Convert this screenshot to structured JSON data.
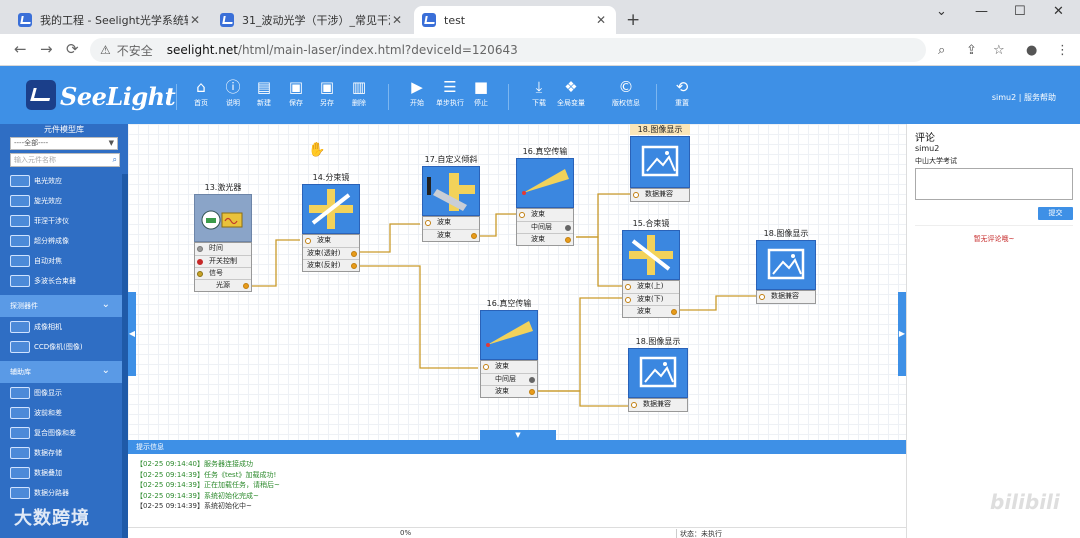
{
  "browser": {
    "tabs": [
      {
        "title": "我的工程 - Seelight光学系统辅助..."
      },
      {
        "title": "31_波动光学（干涉）_常见干涉..."
      },
      {
        "title": "test"
      }
    ],
    "url_warning": "不安全",
    "url_host": "seelight.net",
    "url_path": "/html/main-laser/index.html?deviceId=120643"
  },
  "app": {
    "logo_text": "SeeLight",
    "toolbar": [
      {
        "label": "首页",
        "icon": "home-icon",
        "glyph": "⌂"
      },
      {
        "label": "说明",
        "icon": "info-icon",
        "glyph": "ⓘ"
      },
      {
        "label": "新建",
        "icon": "new-file-icon",
        "glyph": "▤"
      },
      {
        "label": "保存",
        "icon": "save-icon",
        "glyph": "▣"
      },
      {
        "label": "另存",
        "icon": "save-as-icon",
        "glyph": "▣"
      },
      {
        "label": "删除",
        "icon": "delete-icon",
        "glyph": "▥"
      },
      {
        "label": "开始",
        "icon": "play-icon",
        "glyph": "▶"
      },
      {
        "label": "单步执行",
        "icon": "step-icon",
        "glyph": "☰"
      },
      {
        "label": "停止",
        "icon": "stop-icon",
        "glyph": "■"
      },
      {
        "label": "下载",
        "icon": "download-icon",
        "glyph": "⤓"
      },
      {
        "label": "全局变量",
        "icon": "global-var-icon",
        "glyph": "❖"
      },
      {
        "label": "版权信息",
        "icon": "copyright-icon",
        "glyph": "©"
      },
      {
        "label": "重置",
        "icon": "reset-icon",
        "glyph": "⟲"
      }
    ],
    "user": "simu2",
    "service": "服务帮助"
  },
  "sidebar": {
    "title": "元件模型库",
    "select_value": "----全部----",
    "search_placeholder": "输入元件名称",
    "items_top": [
      "电光效应",
      "旋光效应",
      "菲涅干涉仪",
      "超分辨成像",
      "自动对焦",
      "多波长合束器"
    ],
    "group1": "探测器件",
    "items_g1": [
      "成像相机",
      "CCD像机(图像)"
    ],
    "group2": "辅助库",
    "items_g2": [
      "图像显示",
      "波前和差",
      "复合图像和差",
      "数据存储",
      "数据叠加",
      "数据分路器"
    ]
  },
  "nodes": {
    "laser": {
      "title": "13.激光器",
      "ports": [
        "时间",
        "开关控制",
        "信号",
        "光源"
      ]
    },
    "splitter": {
      "title": "14.分束镜",
      "ports": [
        "波束",
        "波束(透射)",
        "波束(反射)"
      ]
    },
    "tilt": {
      "title": "17.自定义倾斜",
      "ports": [
        "波束",
        "波束"
      ]
    },
    "vac1": {
      "title": "16.真空传输",
      "ports": [
        "波束",
        "中间层",
        "波束"
      ]
    },
    "disp1": {
      "title": "18.图像显示",
      "ports": [
        "数据兼容"
      ]
    },
    "combiner": {
      "title": "15.合束镜",
      "ports": [
        "波束(上)",
        "波束(下)",
        "波束"
      ]
    },
    "disp2": {
      "title": "18.图像显示",
      "ports": [
        "数据兼容"
      ]
    },
    "vac2": {
      "title": "16.真空传输",
      "ports": [
        "波束",
        "中间层",
        "波束"
      ]
    },
    "disp3": {
      "title": "18.图像显示",
      "ports": [
        "数据兼容"
      ]
    }
  },
  "comments": {
    "title": "评论",
    "user": "simu2",
    "course": "中山大学考试",
    "submit": "提交",
    "empty": "暂无评论哦~"
  },
  "log": {
    "header": "提示信息",
    "lines": [
      "【02-25 09:14:40】服务器连接成功",
      "【02-25 09:14:39】任务《test》加载成功!",
      "【02-25 09:14:39】正在加载任务，请稍后~",
      "【02-25 09:14:39】系统初始化完成~",
      "【02-25 09:14:39】系统初始化中~"
    ],
    "progress": "0%",
    "status": "状态：未执行"
  },
  "watermarks": {
    "left": "大数跨境",
    "right": "bilibili"
  }
}
